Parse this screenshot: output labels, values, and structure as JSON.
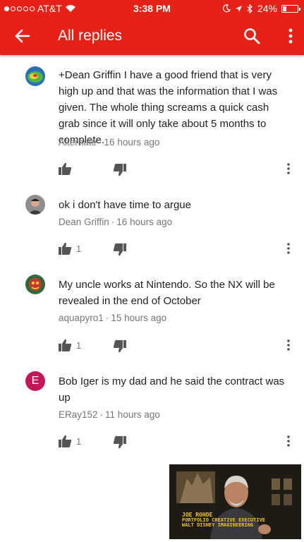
{
  "status_bar": {
    "carrier": "AT&T",
    "time": "3:38 PM",
    "battery": "24%",
    "battery_level": 0.24,
    "icons": [
      "signal-dots-icon",
      "wifi-icon",
      "moon-icon",
      "location-arrow-icon",
      "bluetooth-icon",
      "battery-icon"
    ]
  },
  "app_bar": {
    "title": "All replies",
    "icons": [
      "back-arrow-icon",
      "search-icon",
      "more-vert-icon"
    ]
  },
  "colors": {
    "brand_red": "#e62117",
    "meta_gray": "#767676",
    "text": "#222222",
    "letter_avatar": "#c2185b"
  },
  "comments": [
    {
      "text": "+Dean Griffin I have a good friend that is very high up and that was the information that I was given. The whole thing screams a quick cash grab since it will only take about 5 months to complete.",
      "author": "Alternate",
      "time": "16 hours ago",
      "likes": "",
      "avatar_letter": ""
    },
    {
      "text": "ok i don't have time to argue",
      "author": "Dean Griffin",
      "time": "16 hours ago",
      "likes": "1",
      "avatar_letter": ""
    },
    {
      "text": "My uncle works at Nintendo. So the NX will be revealed in the end of October",
      "author": "aquapyro1",
      "time": "15 hours ago",
      "likes": "1",
      "avatar_letter": ""
    },
    {
      "text": "Bob Iger is my dad and he said the contract was up",
      "author": "ERay152",
      "time": "11 hours ago",
      "likes": "1",
      "avatar_letter": "E"
    }
  ],
  "mini_player": {
    "caption_name": "JOE ROHDE",
    "caption_line1": "PORTFOLIO CREATIVE EXECUTIVE",
    "caption_line2": "WALT DISNEY IMAGINEERING"
  }
}
